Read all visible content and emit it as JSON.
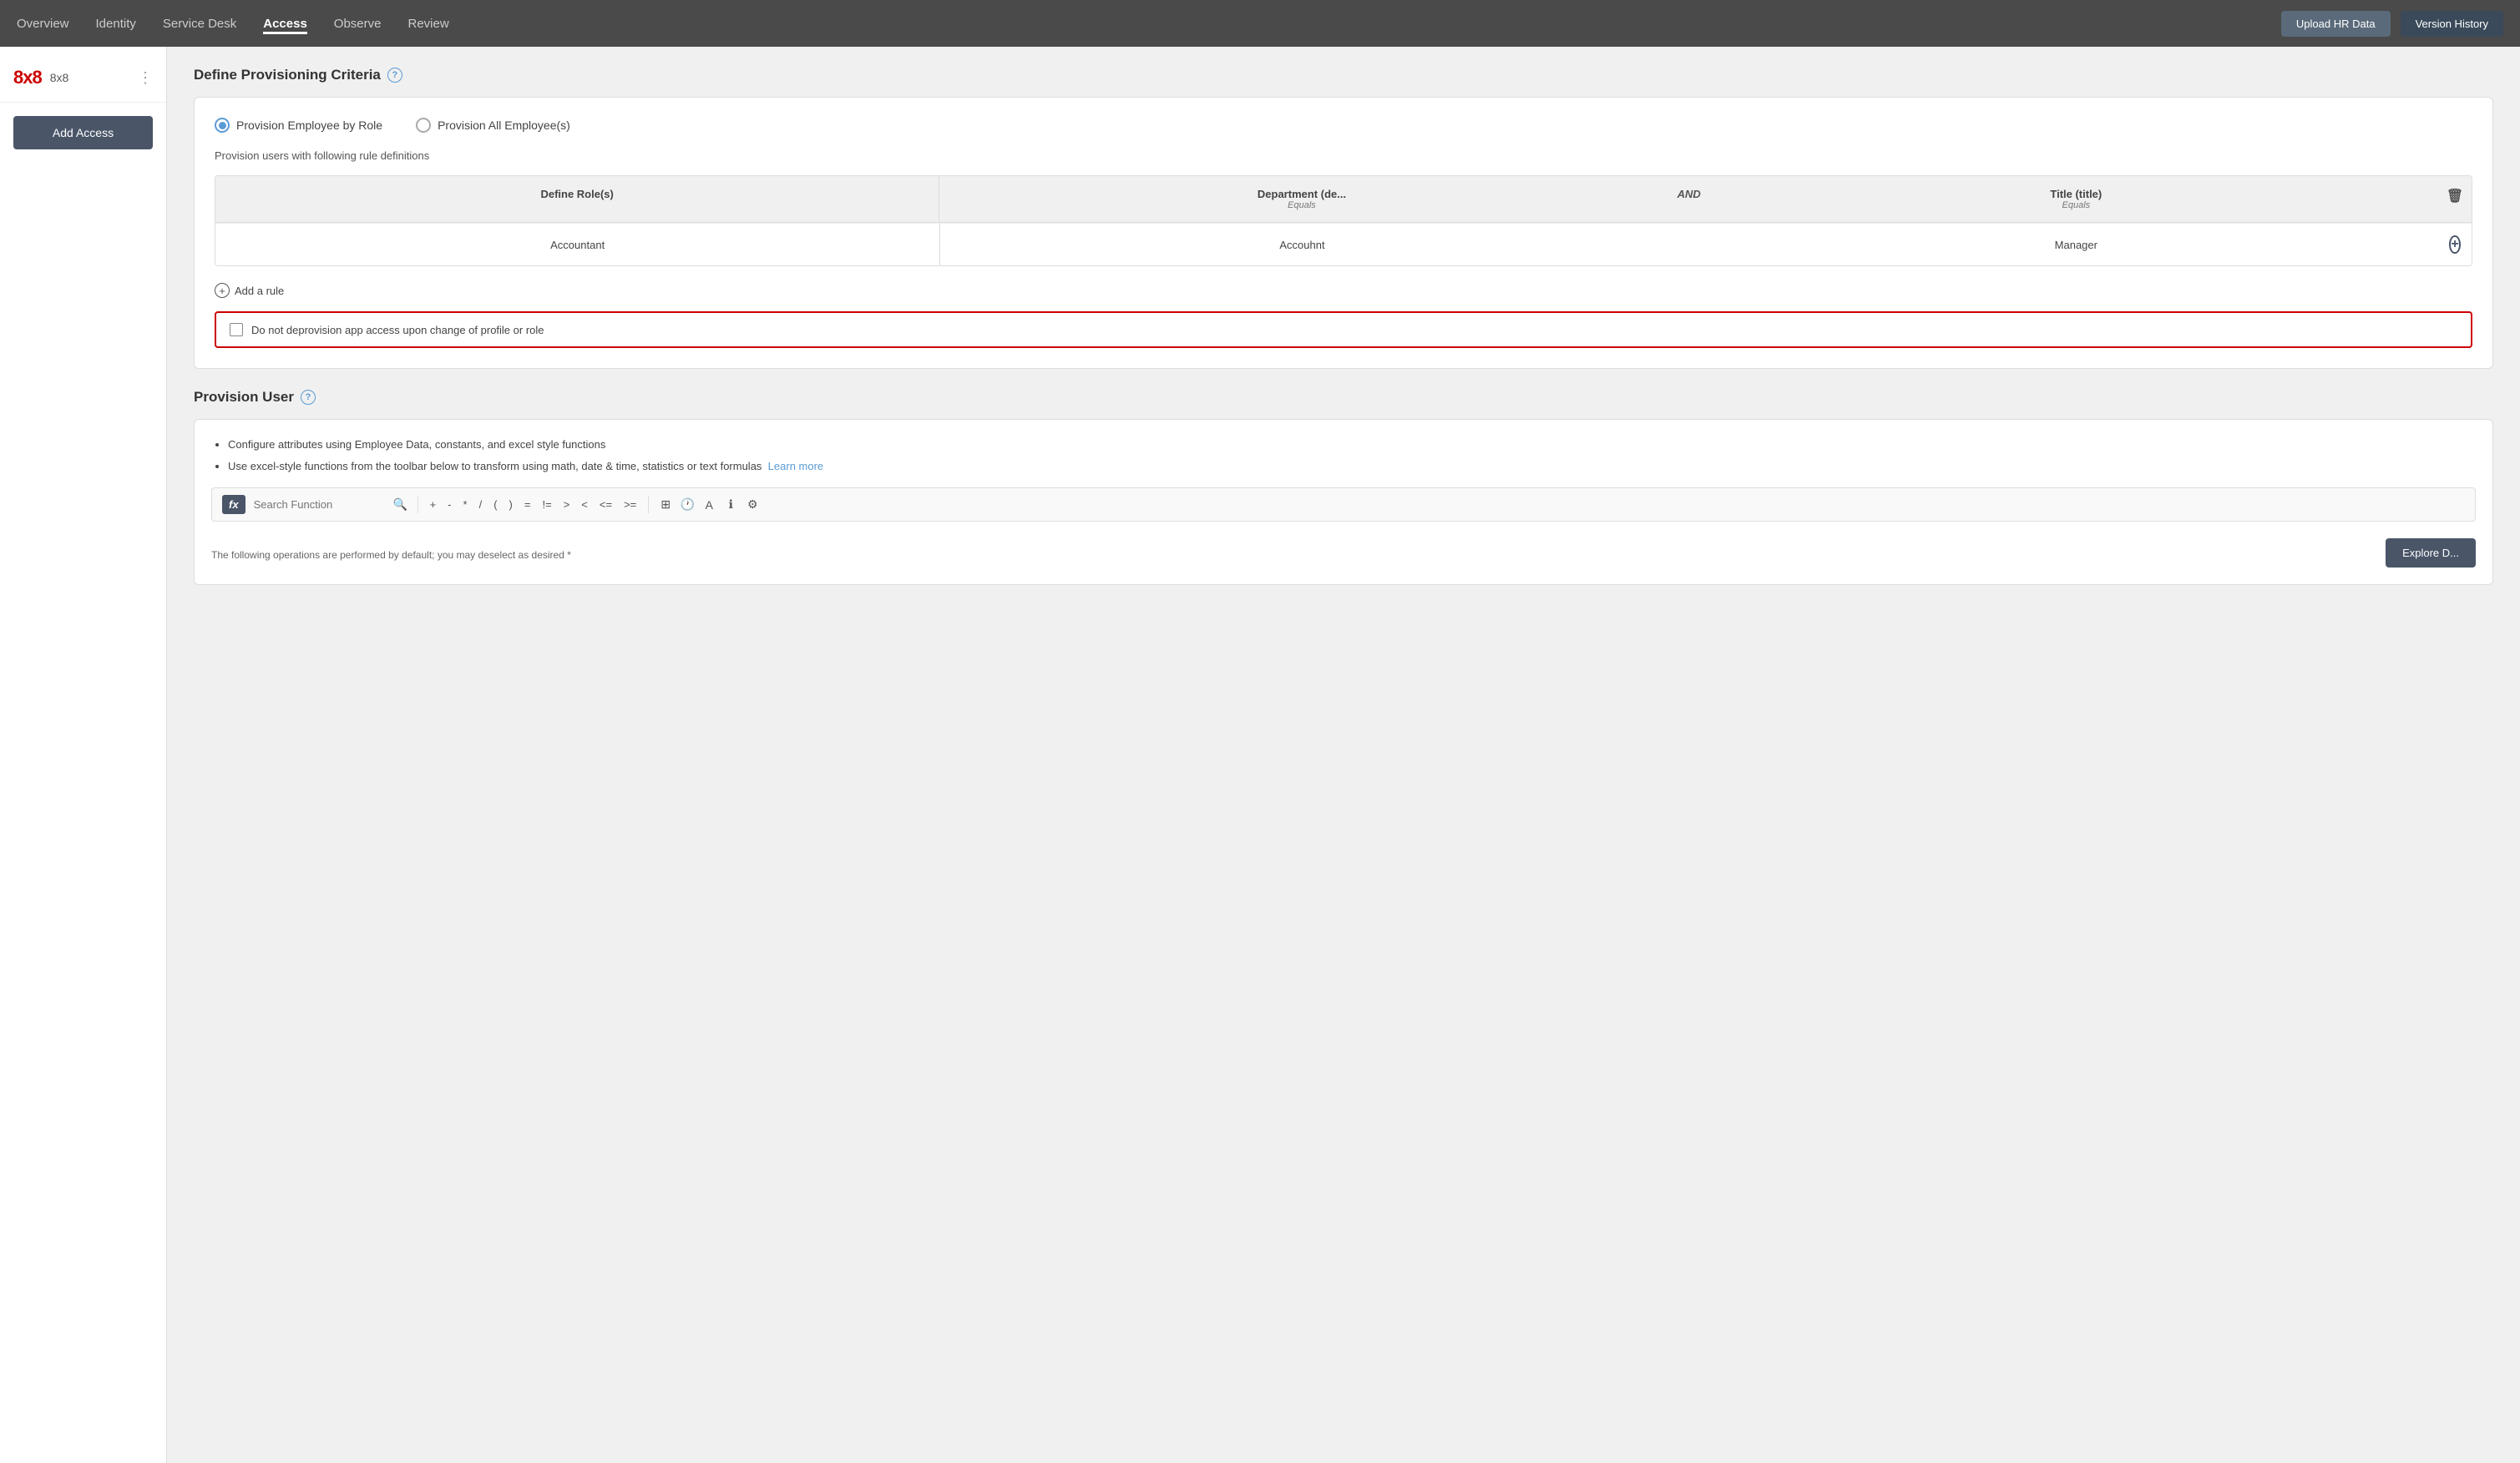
{
  "nav": {
    "items": [
      {
        "label": "Overview",
        "active": false
      },
      {
        "label": "Identity",
        "active": false
      },
      {
        "label": "Service Desk",
        "active": false
      },
      {
        "label": "Access",
        "active": true
      },
      {
        "label": "Observe",
        "active": false
      },
      {
        "label": "Review",
        "active": false
      }
    ],
    "upload_hr_data": "Upload HR Data",
    "version_history": "Version History"
  },
  "sidebar": {
    "brand_logo": "8x8",
    "brand_name": "8x8",
    "add_access": "Add Access"
  },
  "main": {
    "define_provisioning": {
      "title": "Define Provisioning Criteria",
      "radio_option_1": "Provision Employee by Role",
      "radio_option_2": "Provision All Employee(s)",
      "rule_desc": "Provision users with following rule definitions",
      "table": {
        "col1": "Define Role(s)",
        "col2": "Department (de...",
        "col2_sub": "Equals",
        "col3_and": "AND",
        "col4": "Title (title)",
        "col4_sub": "Equals",
        "row": {
          "role": "Accountant",
          "department": "Accouhnt",
          "title": "Manager"
        }
      },
      "add_rule": "Add a rule",
      "checkbox_label": "Do not deprovision app access upon change of profile or role"
    },
    "provision_user": {
      "title": "Provision User",
      "bullet1": "Configure attributes using Employee Data, constants, and excel style functions",
      "bullet2": "Use excel-style functions from the toolbar below to transform using math, date & time, statistics or text formulas",
      "learn_more": "Learn more",
      "search_placeholder": "Search Function",
      "toolbar_ops": [
        "+",
        "-",
        "*",
        "/",
        "(",
        ")",
        "=",
        "!=",
        ">",
        "<",
        "<=",
        ">="
      ],
      "bottom_note": "The following operations are performed by default; you may deselect as desired *",
      "explore_btn": "Explore D..."
    }
  }
}
